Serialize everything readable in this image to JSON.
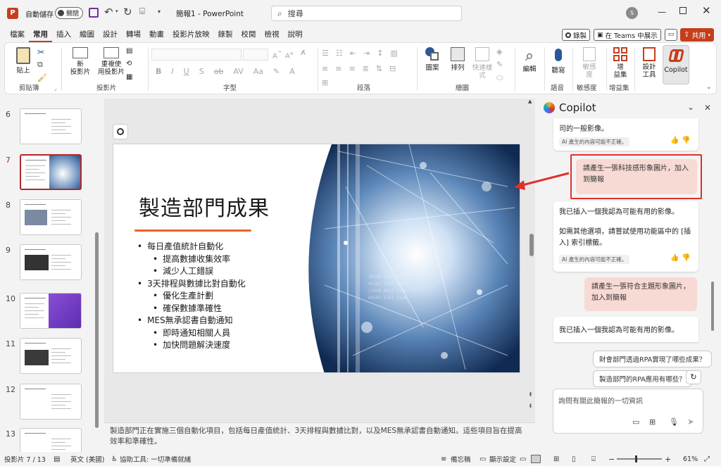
{
  "titlebar": {
    "autosave_label": "自動儲存",
    "autosave_state": "關閉",
    "doc_title": "簡報1 - PowerPoint",
    "search_placeholder": "搜尋",
    "avatar_initial": "S"
  },
  "tabs": [
    "檔案",
    "常用",
    "插入",
    "繪圖",
    "設計",
    "轉場",
    "動畫",
    "投影片放映",
    "錄製",
    "校閱",
    "檢視",
    "說明"
  ],
  "active_tab": "常用",
  "tab_actions": {
    "record": "錄製",
    "teams": "在 Teams 中展示",
    "share": "共用"
  },
  "ribbon": {
    "paste": "貼上",
    "clipboard_group": "剪貼簿",
    "new_slide": "新\n投影片",
    "reuse_slide": "重複使\n用投影片",
    "slides_group": "投影片",
    "font_group": "字型",
    "paragraph_group": "段落",
    "picture": "圖案",
    "arrange": "排列",
    "quick_styles": "快速樣\n式",
    "drawing_group": "繪圖",
    "editing": "編輯",
    "dictate": "聽寫",
    "voice_group": "語音",
    "sensitivity": "敏感\n度",
    "sensitivity_group": "敏感度",
    "addins": "增\n益集",
    "addins_group": "增益集",
    "designer": "設計\n工具",
    "copilot": "Copilot"
  },
  "thumbnails": [
    {
      "num": "6",
      "title": "..."
    },
    {
      "num": "7",
      "title": "製造部門成果",
      "selected": true
    },
    {
      "num": "8",
      "title": "..."
    },
    {
      "num": "9",
      "title": "..."
    },
    {
      "num": "10",
      "title": "..."
    },
    {
      "num": "11",
      "title": "..."
    },
    {
      "num": "12",
      "title": "..."
    },
    {
      "num": "13",
      "title": "..."
    }
  ],
  "slide": {
    "title": "製造部門成果",
    "bullets": [
      {
        "level": 1,
        "text": "每日產值統計自動化"
      },
      {
        "level": 2,
        "text": "提高數據收集效率"
      },
      {
        "level": 2,
        "text": "減少人工錯誤"
      },
      {
        "level": 1,
        "text": "3天排程與數據比對自動化"
      },
      {
        "level": 2,
        "text": "優化生產計劃"
      },
      {
        "level": 2,
        "text": "確保數據準確性"
      },
      {
        "level": 1,
        "text": "MES無承認書自動通知"
      },
      {
        "level": 2,
        "text": "即時通知相關人員"
      },
      {
        "level": 2,
        "text": "加快問題解決速度"
      }
    ],
    "accent_color": "#e8632a"
  },
  "notes": "製造部門正在實施三個自動化項目，包括每日產值統計、3天排程與數據比對，以及MES無承認書自動通知。這些項目旨在提高效率和準確性。",
  "copilot": {
    "title": "Copilot",
    "msg0_text": "司的一般影像。",
    "ai_note": "AI 產生的內容可能不正確。",
    "user_msg1": "請產生一張科技感形象圖片，加入到簡報",
    "ai_msg1_a": "我已插入一個我認為可能有用的影像。",
    "ai_msg1_b": "如需其他選項，請嘗試使用功能區中的 [插入] 索引標籤。",
    "user_msg2": "請產生一張符合主題形象圖片，加入到簡報",
    "ai_msg2": "我已插入一個我認為可能有用的影像。",
    "suggestion1": "財會部門透過RPA實現了哪些成果？",
    "suggestion2": "製造部門的RPA應用有哪些？",
    "input_placeholder": "詢問有關此簡報的一切資訊"
  },
  "status": {
    "slide_pos": "投影片 7 / 13",
    "language": "英文 (美國)",
    "accessibility": "協助工具: 一切準備就緒",
    "notes": "備忘稿",
    "display_settings": "顯示設定",
    "zoom": "61%"
  }
}
